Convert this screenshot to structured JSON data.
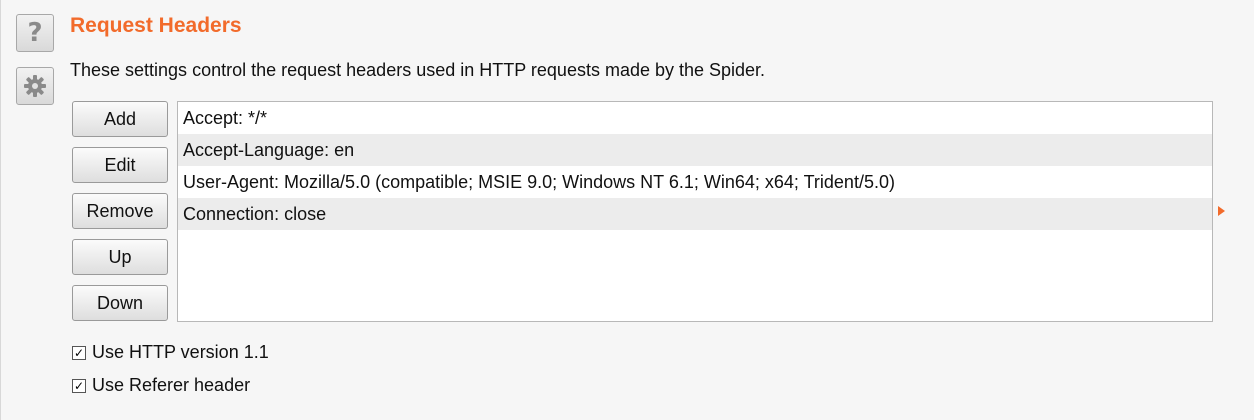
{
  "sidebar": {
    "help_icon": "question-mark-icon",
    "settings_icon": "gear-icon"
  },
  "section": {
    "title": "Request Headers",
    "description": "These settings control the request headers used in HTTP requests made by the Spider."
  },
  "buttons": {
    "add": "Add",
    "edit": "Edit",
    "remove": "Remove",
    "up": "Up",
    "down": "Down"
  },
  "headers": [
    "Accept: */*",
    "Accept-Language: en",
    "User-Agent: Mozilla/5.0 (compatible; MSIE 9.0; Windows NT 6.1; Win64; x64; Trident/5.0)",
    "Connection: close"
  ],
  "options": [
    {
      "label": "Use HTTP version 1.1",
      "checked": true
    },
    {
      "label": "Use Referer header",
      "checked": true
    }
  ],
  "colors": {
    "accent": "#f26b2b",
    "alt_row": "#ececec"
  }
}
